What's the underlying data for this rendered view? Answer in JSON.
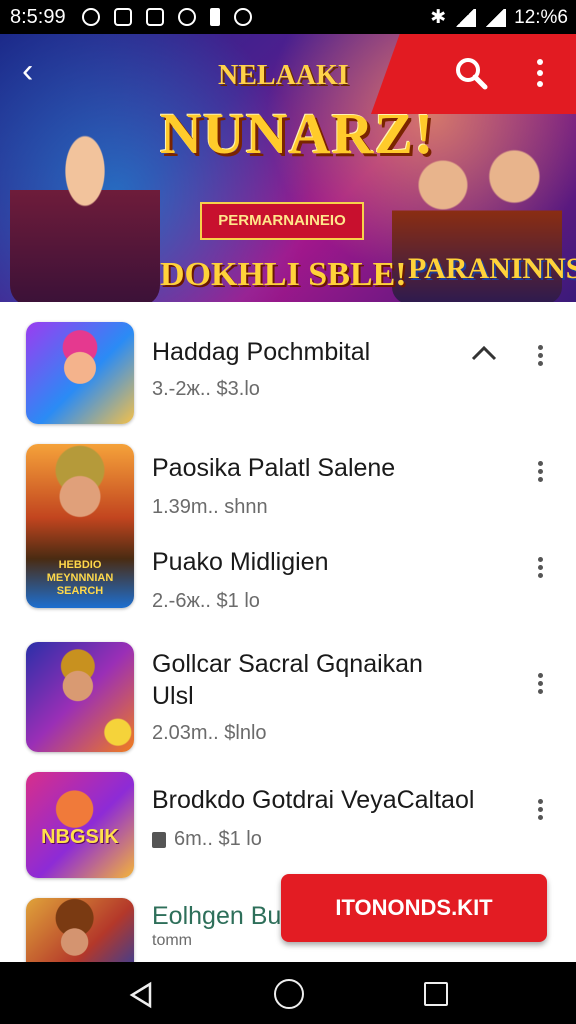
{
  "status_bar": {
    "time": "8:5:99",
    "right_text": "12:%6",
    "icons": [
      "notification-icon",
      "image-icon",
      "media-icon",
      "info-icon",
      "battery-icon",
      "settings-icon",
      "bluetooth-icon",
      "wifi-icon",
      "signal-icon"
    ]
  },
  "hero": {
    "title_top": "NELAAKI",
    "title_main": "NUNARZ!",
    "ribbon": "PERMARNAINEIO",
    "subtitle": "DOKHLI SBLE!",
    "badge": "PARANINNS",
    "accent_color": "#e21b22"
  },
  "list": [
    {
      "title": "Haddag Pochmbital",
      "meta": "3.-2ж.. $3.lo",
      "expanded": true
    },
    {
      "title": "Paosika Palatl Salene",
      "meta": "1.39m.. shnn"
    },
    {
      "title": "Puako Midligien",
      "meta": "2.-6ж.. $1 lo"
    },
    {
      "title": "Gollcar Sacral Gqnaikan",
      "title2": "Ulsl",
      "meta": "2.03m.. $lnlo"
    },
    {
      "title": "Brodkdo Gotdrai VeyaCaltaol",
      "meta": "6m.. $1 lo"
    },
    {
      "title": "Eolhgen Bu",
      "meta": "tomm"
    }
  ],
  "thumb_labels": {
    "thumb2": "HEBDIO MEYNNNIAN SEARCH",
    "thumb4": "NBGSIK"
  },
  "fab": {
    "label": "ITONONDS.KIT"
  }
}
